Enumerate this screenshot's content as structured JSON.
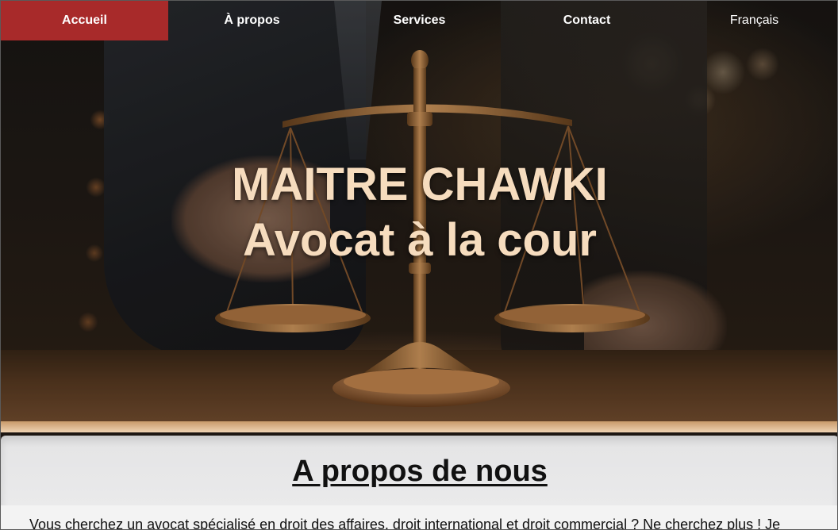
{
  "nav": {
    "items": [
      {
        "label": "Accueil",
        "active": true
      },
      {
        "label": "À propos",
        "active": false
      },
      {
        "label": "Services",
        "active": false
      },
      {
        "label": "Contact",
        "active": false
      }
    ],
    "language": "Français"
  },
  "hero": {
    "title_line1": "MAITRE CHAWKI",
    "title_line2": "Avocat à la cour"
  },
  "about": {
    "title": "A propos de nous",
    "text": "Vous cherchez un avocat spécialisé en droit des affaires, droit international et droit commercial ? Ne cherchez plus ! Je"
  },
  "colors": {
    "accent": "#a82a2a",
    "hero_text": "#f6dcbe"
  }
}
